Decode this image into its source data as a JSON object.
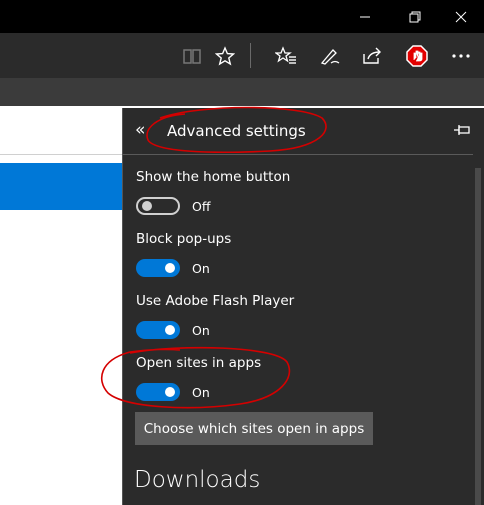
{
  "window_controls": {
    "minimize_icon": "minimize-icon",
    "restore_icon": "restore-icon",
    "close_icon": "close-icon"
  },
  "toolbar": {
    "icons": [
      "reading-view-icon",
      "favorite-star-icon",
      "hub-icon",
      "web-note-icon",
      "share-icon",
      "adblock-icon",
      "more-icon"
    ]
  },
  "panel": {
    "back_glyph": "«",
    "title": "Advanced settings",
    "pin_icon": "pin-icon"
  },
  "settings": [
    {
      "label": "Show the home button",
      "state": "Off",
      "on": false
    },
    {
      "label": "Block pop-ups",
      "state": "On",
      "on": true
    },
    {
      "label": "Use Adobe Flash Player",
      "state": "On",
      "on": true
    },
    {
      "label": "Open sites in apps",
      "state": "On",
      "on": true
    }
  ],
  "choose_button": "Choose which sites open in apps",
  "downloads_heading": "Downloads",
  "colors": {
    "accent": "#0078d7",
    "panel_bg": "#2b2b2b",
    "annotation": "#d40000"
  }
}
